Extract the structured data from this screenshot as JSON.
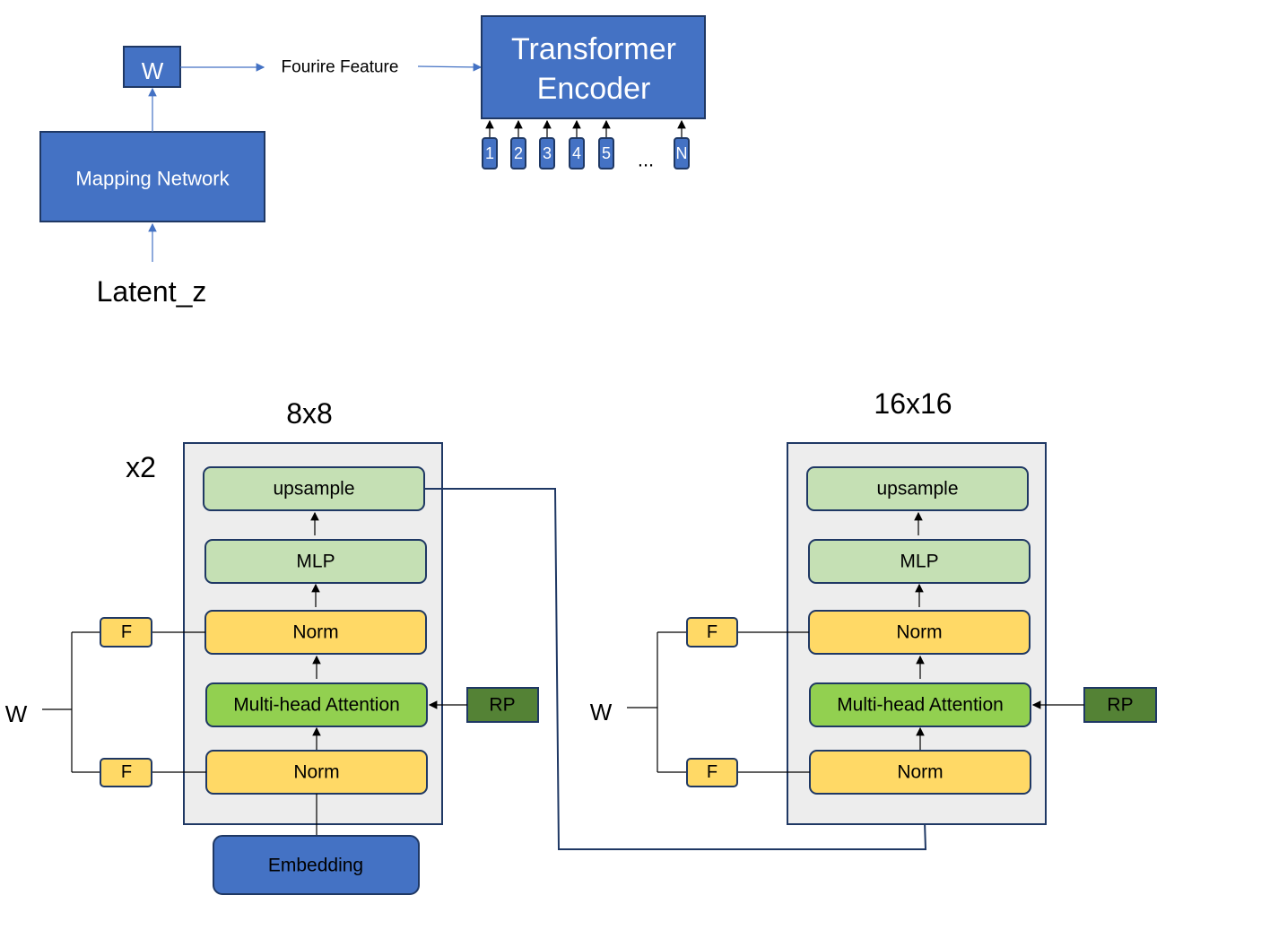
{
  "top": {
    "w_label": "W",
    "mapping_network": "Mapping Network",
    "latent": "Latent_z",
    "fourier_feature": "Fourire Feature",
    "encoder_line1": "Transformer",
    "encoder_line2": "Encoder",
    "tokens": [
      "1",
      "2",
      "3",
      "4",
      "5",
      "N"
    ],
    "ellipsis": "..."
  },
  "stage1": {
    "title": "8x8",
    "repeat": "x2",
    "w": "W",
    "upsample": "upsample",
    "mlp": "MLP",
    "norm_top": "Norm",
    "attention": "Multi-head Attention",
    "norm_bottom": "Norm",
    "f": "F",
    "rp": "RP",
    "embedding": "Embedding"
  },
  "stage2": {
    "title": "16x16",
    "w": "W",
    "upsample": "upsample",
    "mlp": "MLP",
    "norm_top": "Norm",
    "attention": "Multi-head Attention",
    "norm_bottom": "Norm",
    "f": "F",
    "rp": "RP"
  },
  "colors": {
    "blue": "#4472c4",
    "light_green": "#c5e0b4",
    "yellow": "#ffd966",
    "green": "#92d050",
    "dark_green": "#548235",
    "container": "#ededed"
  }
}
